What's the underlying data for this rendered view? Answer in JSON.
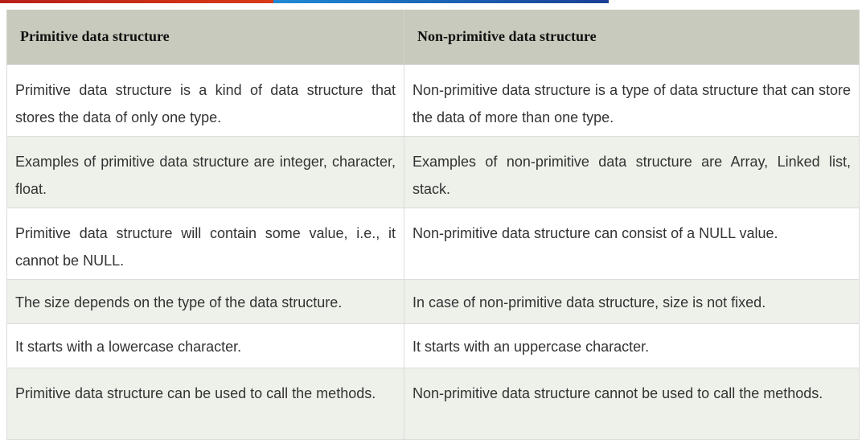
{
  "theme": {
    "header_bg": "#c8cabd",
    "row_alt_bg": "#eef1ea",
    "stripe_red": "#c82a18",
    "stripe_blue": "#1a6fc4"
  },
  "table": {
    "headers": [
      "Primitive data structure",
      "Non-primitive data structure"
    ],
    "rows": [
      [
        "Primitive data structure is a kind of data structure that stores the data of only one type.",
        "Non-primitive data structure is a type of data structure that can store the data of more than one type."
      ],
      [
        "Examples of primitive data structure are integer, character, float.",
        "Examples of non-primitive data structure are Array, Linked list, stack."
      ],
      [
        "Primitive data structure will contain some value, i.e., it cannot be NULL.",
        "Non-primitive data structure can consist of a NULL value."
      ],
      [
        "The size depends on the type of the data structure.",
        "In case of non-primitive data structure, size is not fixed."
      ],
      [
        "It starts with a lowercase character.",
        "It starts with an uppercase character."
      ],
      [
        "Primitive data structure can be used to call the methods.",
        "Non-primitive data structure cannot be used to call the methods."
      ]
    ]
  }
}
